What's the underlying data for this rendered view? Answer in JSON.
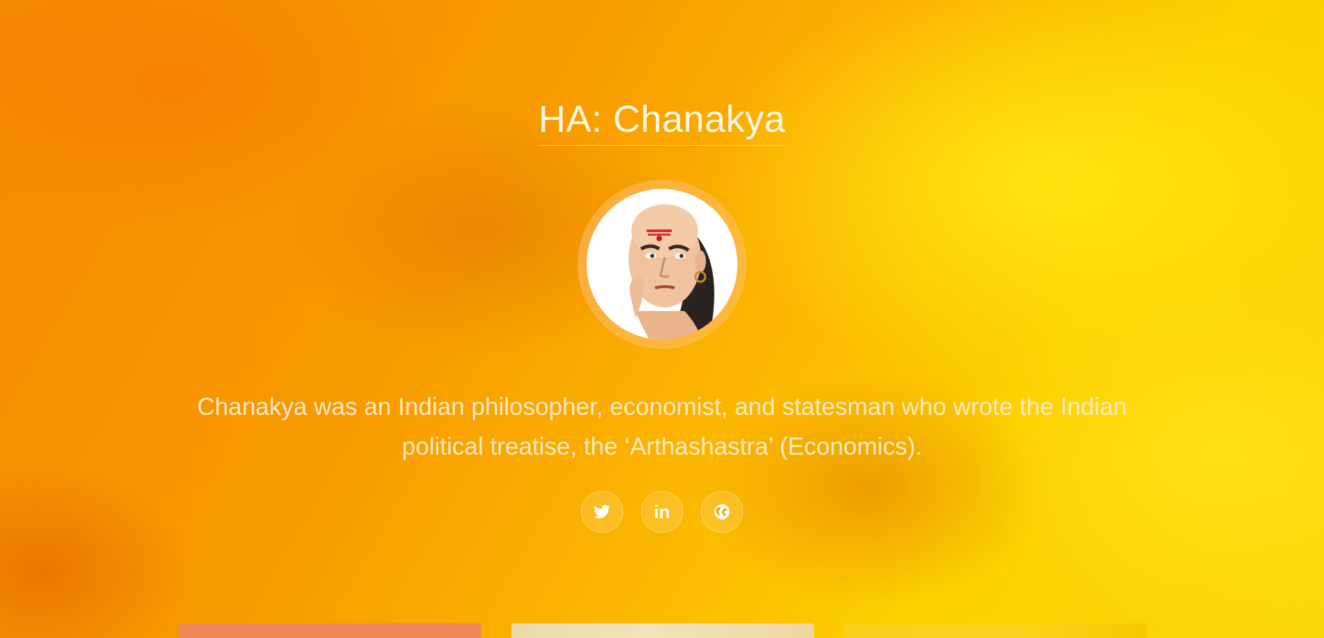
{
  "hero": {
    "title": "HA: Chanakya",
    "bio": "Chanakya was an Indian philosopher, economist, and statesman who wrote the Indian political treatise, the ‘Arthashastra’ (Economics).",
    "avatar_alt": "Chanakya portrait"
  },
  "social": {
    "twitter_icon": "twitter-icon",
    "linkedin_icon": "linkedin-icon",
    "linkedin_label": "in",
    "website_icon": "globe-icon"
  },
  "colors": {
    "background_primary": "#f7a000",
    "background_highlight": "#fdd000",
    "text_light": "#fff6e6",
    "card_1": "#f0885a",
    "card_2": "#ecd9a8",
    "card_3": "#fbd01a"
  },
  "cards": [
    {
      "name": "card-1"
    },
    {
      "name": "card-2"
    },
    {
      "name": "card-3"
    }
  ]
}
